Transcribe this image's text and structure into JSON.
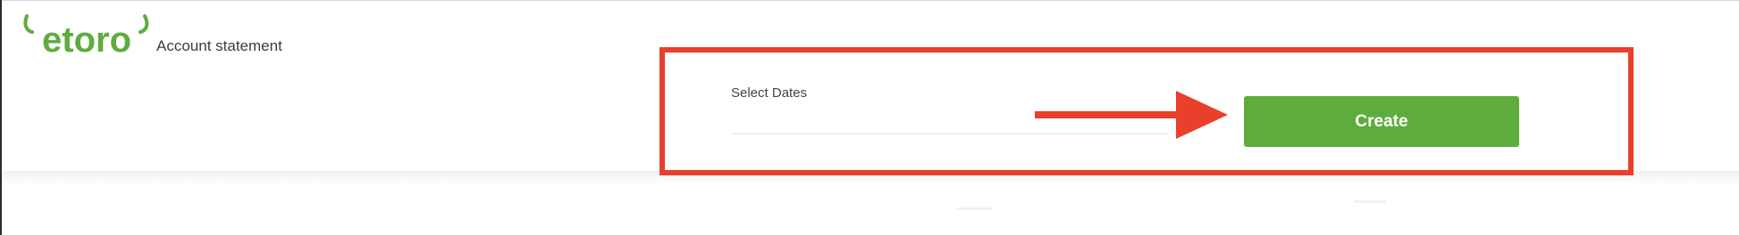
{
  "header": {
    "logo_text": "etoro",
    "page_title": "Account statement"
  },
  "statement_form": {
    "date_label": "Select Dates",
    "date_value": "",
    "create_label": "Create"
  },
  "colors": {
    "brand_green": "#5fac3e",
    "button_green": "#5fac3e",
    "annotation_red": "#e8402b"
  }
}
